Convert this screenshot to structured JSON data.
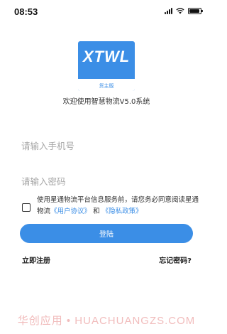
{
  "status_bar": {
    "time": "08:53",
    "battery_level": 0.9
  },
  "logo": {
    "text": "XTWL",
    "subtitle": "货主版"
  },
  "welcome_text": "欢迎使用智慧物流V5.0系统",
  "phone_input": {
    "placeholder": "请输入手机号",
    "value": ""
  },
  "password_input": {
    "placeholder": "请输入密码",
    "value": ""
  },
  "agreement": {
    "checked": false,
    "text_prefix": "使用星通物流平台信息服务前，请您务必同意阅读星通物流",
    "user_agreement": "《用户协议》",
    "conjunction": "和",
    "privacy_policy": "《隐私政策》"
  },
  "login_button": "登陆",
  "register_link": "立即注册",
  "forgot_link": "忘记密码?",
  "watermark": "华创应用 • HUACHUANGZS.COM",
  "colors": {
    "primary": "#3b8ee6",
    "placeholder": "#a6a6a6",
    "text": "#333333"
  }
}
